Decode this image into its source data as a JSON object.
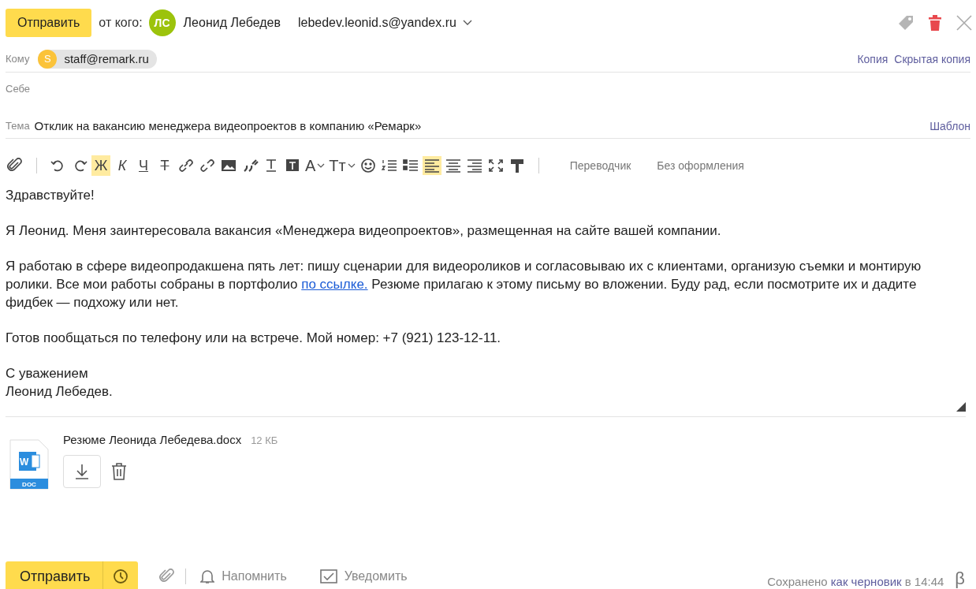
{
  "header": {
    "send_button": "Отправить",
    "from_label": "от кого:",
    "avatar_initials": "ЛС",
    "sender_name": "Леонид Лебедев",
    "sender_email": "lebedev.leonid.s@yandex.ru"
  },
  "to": {
    "label": "Кому",
    "recipients": [
      {
        "initial": "S",
        "email": "staff@remark.ru",
        "color": "#fbc33a"
      }
    ],
    "links": [
      "Копия",
      "Скрытая копия"
    ]
  },
  "self": {
    "label": "Себе"
  },
  "subject": {
    "label": "Тема",
    "value": "Отклик на вакансию менеджера видеопроектов в компанию «Ремарк»",
    "template_link": "Шаблон"
  },
  "toolbar": [
    {
      "kind": "attach",
      "selected": false
    },
    {
      "kind": "sep"
    },
    {
      "kind": "undo",
      "selected": false
    },
    {
      "kind": "redo",
      "selected": false
    },
    {
      "kind": "bold",
      "label": "Ж",
      "selected": true
    },
    {
      "kind": "italic",
      "label": "К",
      "selected": false
    },
    {
      "kind": "underline",
      "label": "Ч",
      "selected": false
    },
    {
      "kind": "strike",
      "label": "Т",
      "selected": false
    },
    {
      "kind": "link",
      "selected": false
    },
    {
      "kind": "unlink",
      "selected": false
    },
    {
      "kind": "image",
      "selected": false
    },
    {
      "kind": "quote",
      "selected": false
    },
    {
      "kind": "textcolor",
      "selected": false
    },
    {
      "kind": "bgcolor",
      "selected": false
    },
    {
      "kind": "dropdown",
      "label": "A",
      "selected": false
    },
    {
      "kind": "dropdown",
      "label": "Tт",
      "selected": false
    },
    {
      "kind": "smile",
      "selected": false
    },
    {
      "kind": "olist",
      "selected": false
    },
    {
      "kind": "ulist",
      "selected": false
    },
    {
      "kind": "alignleft",
      "selected": true
    },
    {
      "kind": "aligncenter",
      "selected": false
    },
    {
      "kind": "alignright",
      "selected": false
    },
    {
      "kind": "fullscreen",
      "selected": false
    },
    {
      "kind": "painter",
      "selected": false
    },
    {
      "kind": "sep"
    },
    {
      "kind": "text",
      "label": "Переводчик"
    },
    {
      "kind": "text",
      "label": "Без оформления"
    }
  ],
  "body": [
    {
      "parts": [
        {
          "kind": "text",
          "text": "Здравствуйте!"
        }
      ]
    },
    {
      "parts": [
        {
          "kind": "text",
          "text": "Я Леонид. Меня заинтересовала вакансия «Менеджера видеопроектов», размещенная на сайте вашей компании."
        }
      ]
    },
    {
      "parts": [
        {
          "kind": "text",
          "text": "Я работаю в сфере видеопродакшена пять лет: пишу сценарии для видеороликов и согласовываю их с клиентами, организую съемки и монтирую ролики. Все мои работы собраны в портфолио "
        },
        {
          "kind": "link",
          "text": "по ссылке."
        },
        {
          "kind": "text",
          "text": " Резюме прилагаю к этому письму во вложении. Буду рад, если посмотрите их и дадите фидбек — подхожу или нет."
        }
      ]
    },
    {
      "parts": [
        {
          "kind": "text",
          "text": "Готов пообщаться по телефону или на встрече. Мой номер: +7 (921) 123-12-11."
        }
      ]
    },
    {
      "lines": [
        "С уважением",
        "Леонид Лебедев."
      ]
    }
  ],
  "attachment": {
    "icon_letter": "W",
    "file_type": "DOC",
    "name": "Резюме Леонида Лебедева.docx",
    "size": "12 КБ"
  },
  "footer": {
    "send_button": "Отправить",
    "remind": "Напомнить",
    "notify": "Уведомить",
    "status": [
      {
        "kind": "text",
        "text": "Сохранено"
      },
      {
        "kind": "link",
        "text": "как черновик"
      },
      {
        "kind": "text",
        "text": "в 14:44"
      }
    ],
    "beta": "β"
  }
}
